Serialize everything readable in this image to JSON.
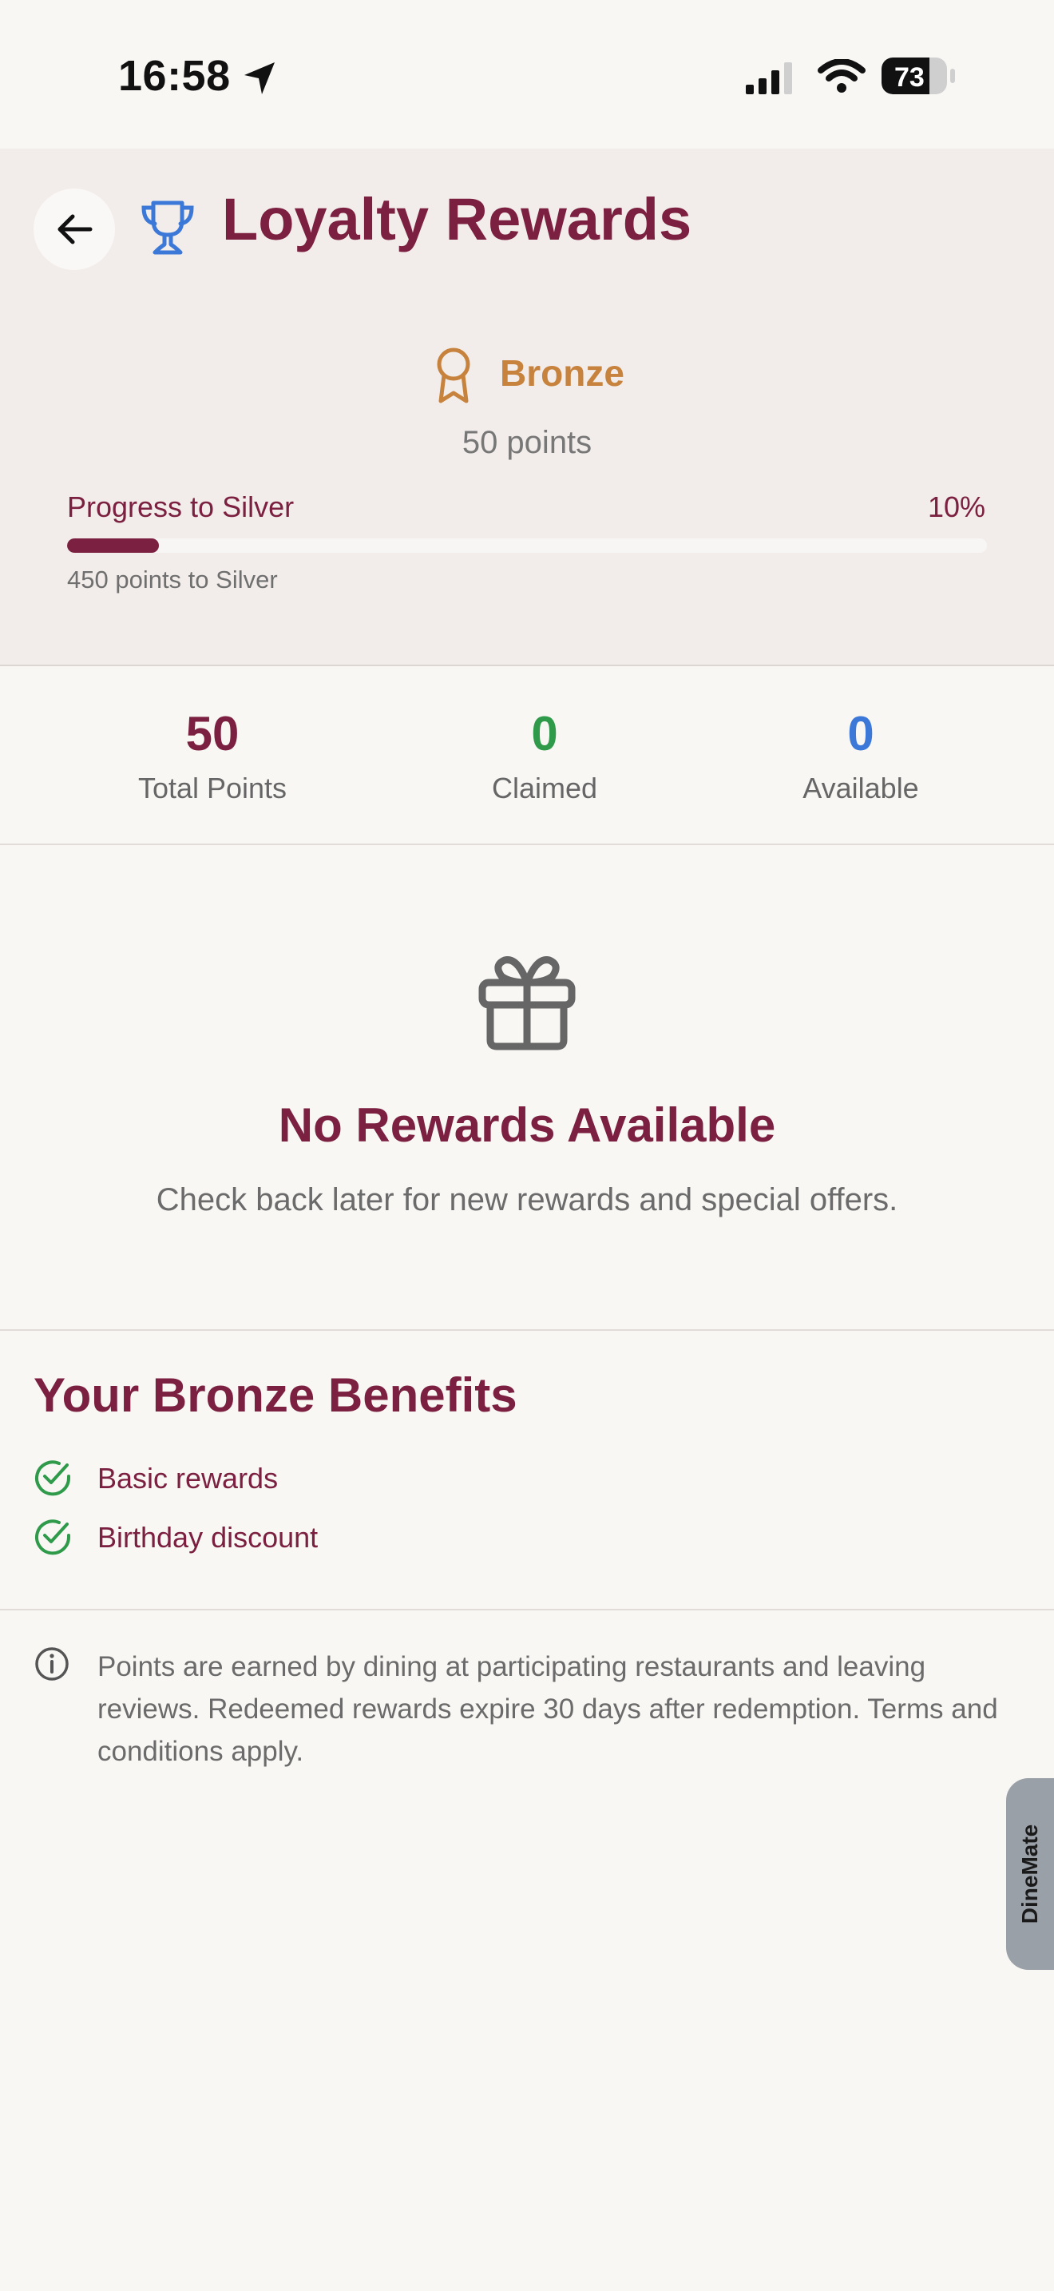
{
  "status_bar": {
    "time": "16:58",
    "battery": "73",
    "icons": [
      "location-arrow-icon",
      "signal-icon",
      "wifi-icon",
      "battery-icon"
    ]
  },
  "header": {
    "title": "Loyalty Rewards",
    "title_icon": "trophy-icon",
    "back_icon": "arrow-left-icon"
  },
  "tier": {
    "name": "Bronze",
    "icon": "award-ribbon-icon",
    "points_text": "50 points",
    "progress_label": "Progress to Silver",
    "progress_percent_text": "10%",
    "progress_fraction": 0.1,
    "progress_sub": "450 points to Silver"
  },
  "stats": [
    {
      "value": "50",
      "label": "Total Points",
      "color": "#7b2040"
    },
    {
      "value": "0",
      "label": "Claimed",
      "color": "#2e9a4a"
    },
    {
      "value": "0",
      "label": "Available",
      "color": "#3b78d8"
    }
  ],
  "empty_state": {
    "icon": "gift-icon",
    "title": "No Rewards Available",
    "description": "Check back later for new rewards and special offers."
  },
  "benefits": {
    "title": "Your Bronze Benefits",
    "items": [
      {
        "label": "Basic rewards",
        "icon": "check-circle-icon"
      },
      {
        "label": "Birthday discount",
        "icon": "check-circle-icon"
      }
    ]
  },
  "note": {
    "icon": "info-icon",
    "text": "Points are earned by dining at participating restaurants and leaving reviews. Redeemed rewards expire 30 days after redemption. Terms and conditions apply."
  },
  "side_tab": {
    "label": "DineMate"
  },
  "colors": {
    "brand": "#7b2040",
    "bronze": "#c7823d",
    "green": "#2e9a4a",
    "blue": "#3b78d8"
  }
}
